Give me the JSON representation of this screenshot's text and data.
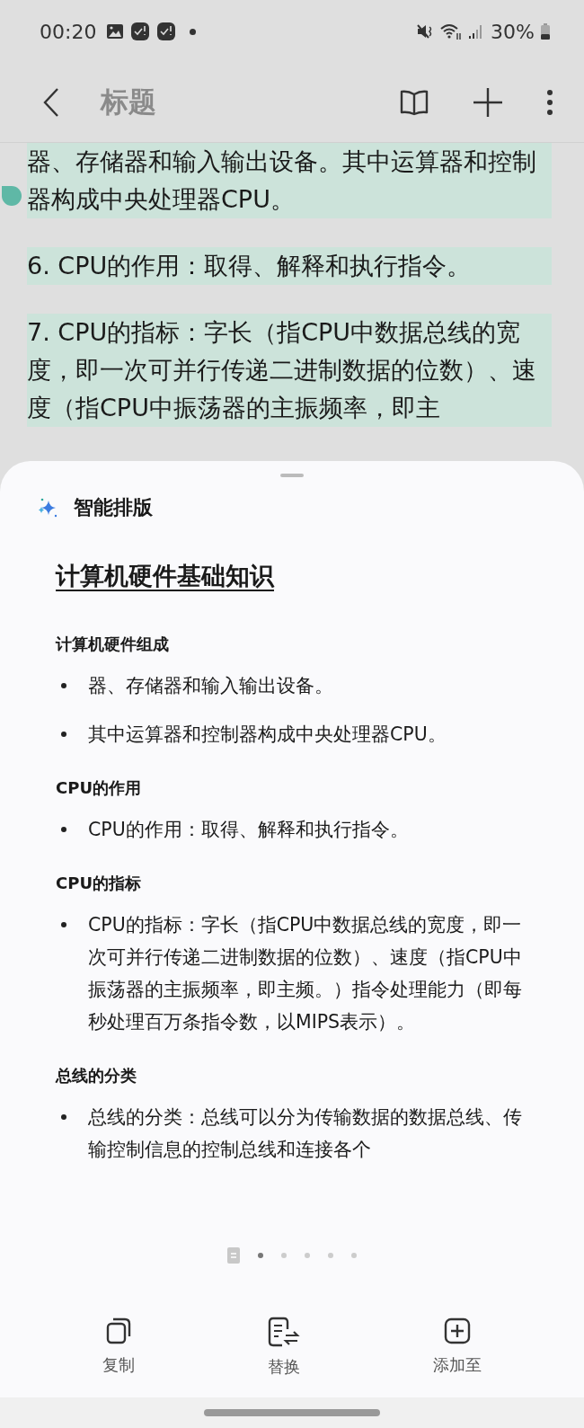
{
  "status_bar": {
    "time": "00:20",
    "battery": "30%"
  },
  "header": {
    "title": "标题"
  },
  "note": {
    "selected": true,
    "paragraphs": [
      "器、存储器和输入输出设备。其中运算器和控制器构成中央处理器CPU。",
      "6. CPU的作用：取得、解释和执行指令。",
      "7. CPU的指标：字长（指CPU中数据总线的宽度，即一次可并行传递二进制数据的位数）、速度（指CPU中振荡器的主振频率，即主"
    ]
  },
  "sheet": {
    "title": "智能排版",
    "heading": "计算机硬件基础知识",
    "sections": [
      {
        "heading": "计算机硬件组成",
        "items": [
          "器、存储器和输入输出设备。",
          "其中运算器和控制器构成中央处理器CPU。"
        ]
      },
      {
        "heading": "CPU的作用",
        "items": [
          "CPU的作用：取得、解释和执行指令。"
        ]
      },
      {
        "heading": "CPU的指标",
        "items": [
          "CPU的指标：字长（指CPU中数据总线的宽度，即一次可并行传递二进制数据的位数）、速度（指CPU中振荡器的主振频率，即主频。）指令处理能力（即每秒处理百万条指令数，以MIPS表示）。"
        ]
      },
      {
        "heading": "总线的分类",
        "items": [
          "总线的分类：总线可以分为传输数据的数据总线、传输控制信息的控制总线和连接各个"
        ]
      }
    ],
    "pages": [
      {
        "selected": true
      },
      {
        "selected": false
      },
      {
        "selected": false
      },
      {
        "selected": false
      },
      {
        "selected": false
      }
    ],
    "actions": [
      {
        "kind": "copy",
        "label": "复制"
      },
      {
        "kind": "replace",
        "label": "替换"
      },
      {
        "kind": "add",
        "label": "添加至"
      }
    ]
  }
}
